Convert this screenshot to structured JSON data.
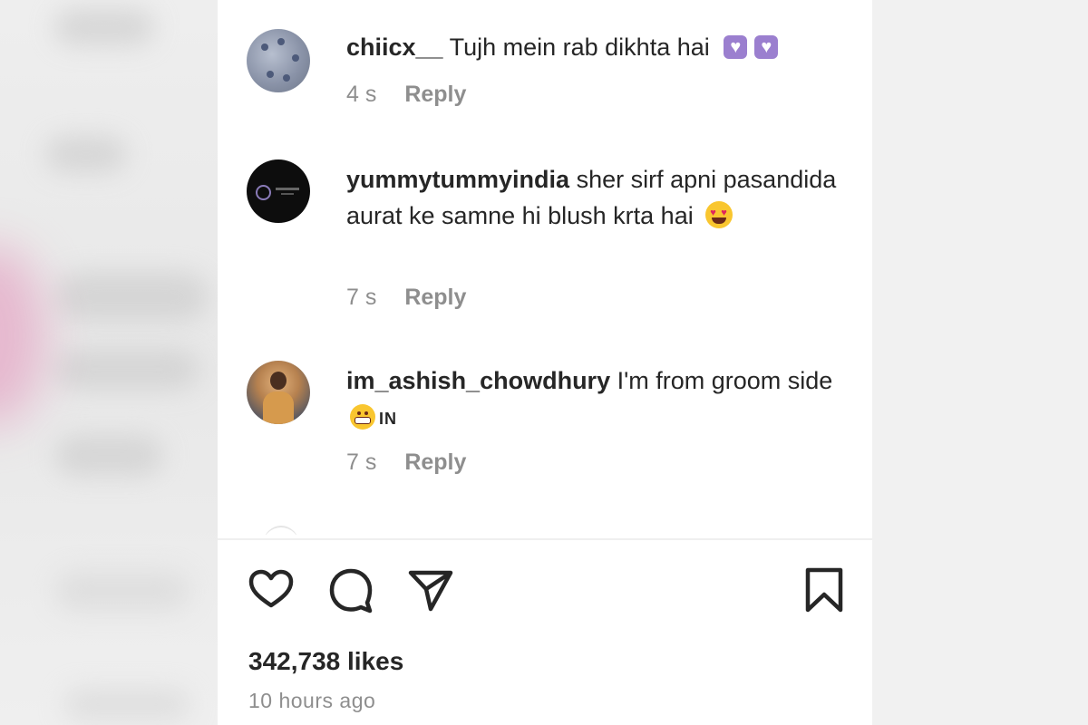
{
  "comments": [
    {
      "username": "chiicx__",
      "text": "Tujh mein rab dikhta hai",
      "emoji": [
        "purple-heart",
        "purple-heart"
      ],
      "time": "4 s",
      "reply_label": "Reply"
    },
    {
      "username": "yummytummyindia",
      "text": "sher sirf apni pasandida aurat ke samne hi blush krta hai",
      "emoji": [
        "heart-eyes"
      ],
      "time": "7 s",
      "reply_label": "Reply"
    },
    {
      "username": "im_ashish_chowdhury",
      "text": "I'm from groom side",
      "emoji": [
        "grinning-face"
      ],
      "flag": "IN",
      "time": "7 s",
      "reply_label": "Reply"
    }
  ],
  "actions": [
    "heart-icon",
    "comment-icon",
    "share-icon",
    "bookmark-icon"
  ],
  "likes": "342,738 likes",
  "posted": "10 hours ago",
  "colors": {
    "text": "#262626",
    "secondary": "#8e8e8e",
    "background": "#ffffff"
  }
}
